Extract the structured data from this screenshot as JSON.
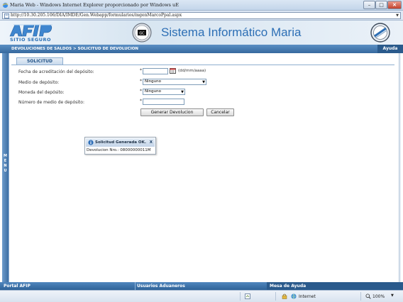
{
  "window": {
    "title": "Maria Web - Windows Internet Explorer proporcionado por Windows uE",
    "url": "http://10.30.205.106/DIA/IMDE/Gen.Webapp/formularios/mgenMarcoPpal.aspx"
  },
  "header": {
    "logo_text": "AFIP",
    "logo_subtitle": "SITIO SEGURO",
    "seal_text": "GC",
    "system_title": "Sistema Informático Maria"
  },
  "navbar": {
    "breadcrumb": "DEVOLUCIONES DE SALDOS > SOLICITUD DE DEVOLUCION",
    "help_label": "Ayuda"
  },
  "side_menu": {
    "label": "MENU"
  },
  "form": {
    "tab_label": "SOLICITUD",
    "fields": {
      "fecha_label": "Fecha de acreditación del depósito:",
      "fecha_value": "",
      "fecha_format": "(dd/mm/aaaa)",
      "medio_label": "Medio de depósito:",
      "medio_value": "Ninguno",
      "moneda_label": "Moneda del depósito:",
      "moneda_value": "Ninguno",
      "numero_label": "Número de medio de depósito:",
      "numero_value": "",
      "required_mark": "*"
    },
    "buttons": {
      "generate": "Generar Devolucion",
      "cancel": "Cancelar"
    }
  },
  "message": {
    "title": "Solicitud Generada OK.",
    "close": "X",
    "body": "Devolucion Nro.: 08000000011M"
  },
  "footer": {
    "portal": "Portal AFIP",
    "usuarios": "Usuarios Aduaneros",
    "mesa": "Mesa de Ayuda"
  },
  "statusbar": {
    "zone": "Internet",
    "zoom": "100%"
  },
  "colors": {
    "accent": "#2d6fb5",
    "nav": "#36699e",
    "footer": "#2f6298"
  }
}
